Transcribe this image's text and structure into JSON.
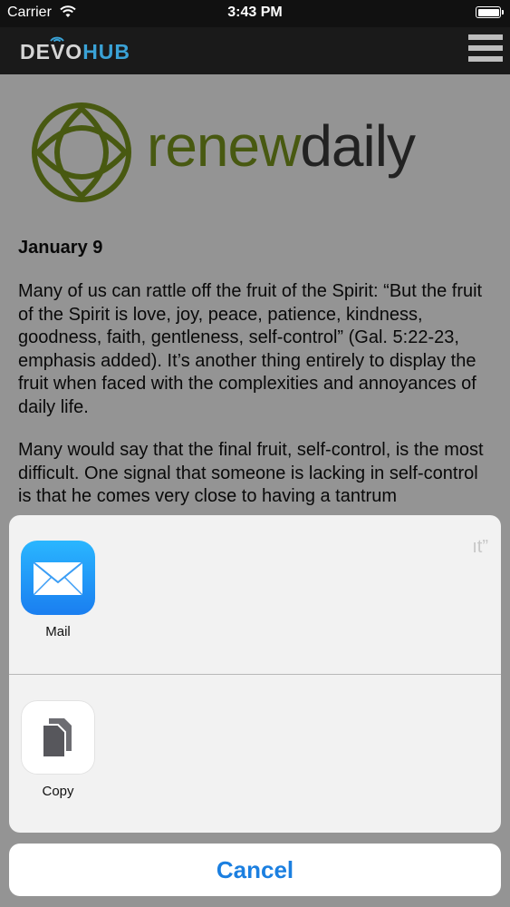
{
  "status_bar": {
    "carrier": "Carrier",
    "time": "3:43 PM"
  },
  "header": {
    "logo_devo": "DEVO",
    "logo_hub": "HUB",
    "brand_color": "#3aa2d6"
  },
  "banner": {
    "brand_renew": "renew",
    "brand_daily": "daily",
    "brand_green": "#7c9a1e"
  },
  "article": {
    "date": "January 9",
    "paragraph_1": "Many of us can rattle off the fruit of the Spirit: “But the fruit of the Spirit is love, joy, peace, patience, kindness, goodness, faith, gentleness, self-control” (Gal. 5:22-23, emphasis added). It’s another thing entirely to display the fruit when faced with the complexities and annoyances of daily life.",
    "paragraph_2": "Many would say that the final fruit, self-control, is the most difficult. One signal that someone is lacking in self-control is that he comes very close to having a tantrum"
  },
  "share_sheet": {
    "items": [
      {
        "label": "Mail",
        "icon": "mail-icon"
      },
      {
        "label": "Copy",
        "icon": "copy-icon"
      }
    ]
  },
  "cancel": {
    "label": "Cancel",
    "color": "#1b7fe0"
  }
}
